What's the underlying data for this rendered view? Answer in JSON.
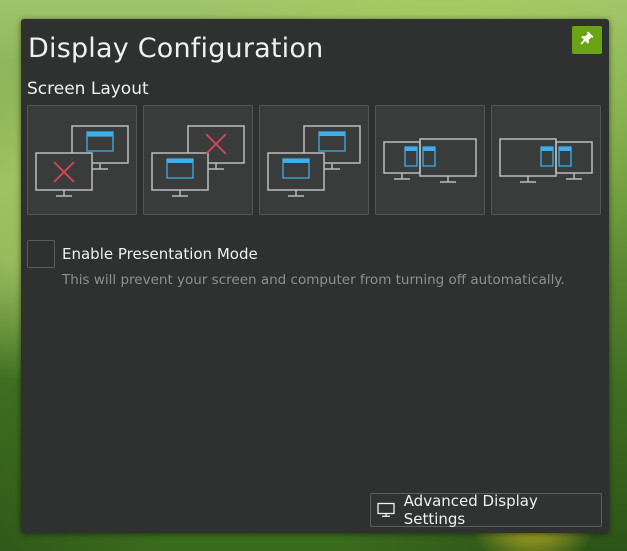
{
  "panel": {
    "title": "Display Configuration",
    "pin_icon": "pin-icon",
    "accent_color": "#6aa313"
  },
  "screen_layout": {
    "label": "Screen Layout",
    "options": [
      {
        "id": "external-only",
        "icon": "monitor-external-only-icon"
      },
      {
        "id": "internal-only",
        "icon": "monitor-internal-only-icon"
      },
      {
        "id": "clone",
        "icon": "monitor-clone-icon"
      },
      {
        "id": "extend-left",
        "icon": "monitor-extend-left-icon"
      },
      {
        "id": "extend-right",
        "icon": "monitor-extend-right-icon"
      }
    ]
  },
  "presentation_mode": {
    "label": "Enable Presentation Mode",
    "description": "This will prevent your screen and computer from turning off automatically.",
    "checked": false
  },
  "footer": {
    "advanced_button_label": "Advanced Display Settings",
    "advanced_button_icon": "monitor-icon"
  }
}
